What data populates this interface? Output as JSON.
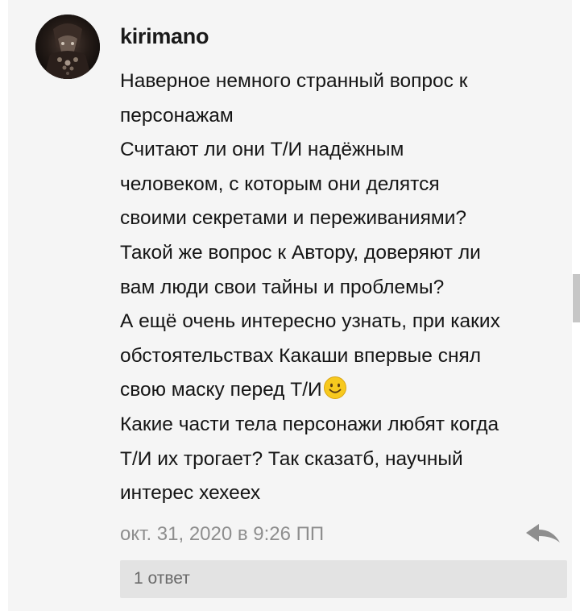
{
  "comment": {
    "username": "kirimano",
    "lines": [
      "Наверное немного странный вопрос к",
      "персонажам",
      "Считают ли они Т/И надёжным",
      "человеком, с которым они делятся",
      "своими секретами и переживаниями?",
      "Такой же вопрос к Автору, доверяют ли",
      "вам люди свои тайны и проблемы?",
      "А ещё очень интересно узнать, при каких",
      "обстоятельствах Какаши впервые снял",
      "свою маску перед Т/И",
      "Какие части тела персонажи любят когда",
      "Т/И их трогает? Так сказатб, научный",
      "интерес хехеех"
    ],
    "timestamp": "окт. 31, 2020 в 9:26 ПП",
    "replies_label": "1 ответ"
  },
  "icons": {
    "avatar": "user-avatar",
    "emoji": "smiling-face-emoji",
    "reply": "reply-arrow-icon"
  },
  "colors": {
    "card_background": "#f5f5f5",
    "text": "#151515",
    "muted": "#8e8e8e",
    "replies_background": "#e3e3e3",
    "emoji": "#f5c518"
  }
}
